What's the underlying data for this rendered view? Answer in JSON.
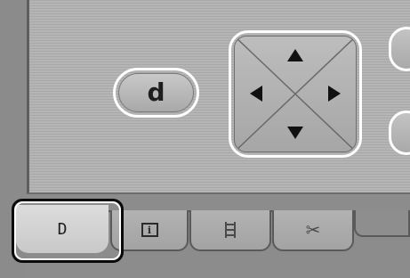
{
  "controls": {
    "d_button_label": "d",
    "dpad": {
      "up": "up-arrow-icon",
      "down": "down-arrow-icon",
      "left": "left-arrow-icon",
      "right": "right-arrow-icon"
    }
  },
  "tabs": {
    "items": [
      {
        "label": "D",
        "selected": true
      },
      {
        "icon": "info-icon",
        "glyph": "i"
      },
      {
        "icon": "film-icon"
      },
      {
        "icon": "scissors-icon",
        "glyph": "✂"
      }
    ]
  },
  "colors": {
    "panel": "#b0b0b0",
    "outline": "#ffffff",
    "focus_ring": "#0a0a0a"
  }
}
